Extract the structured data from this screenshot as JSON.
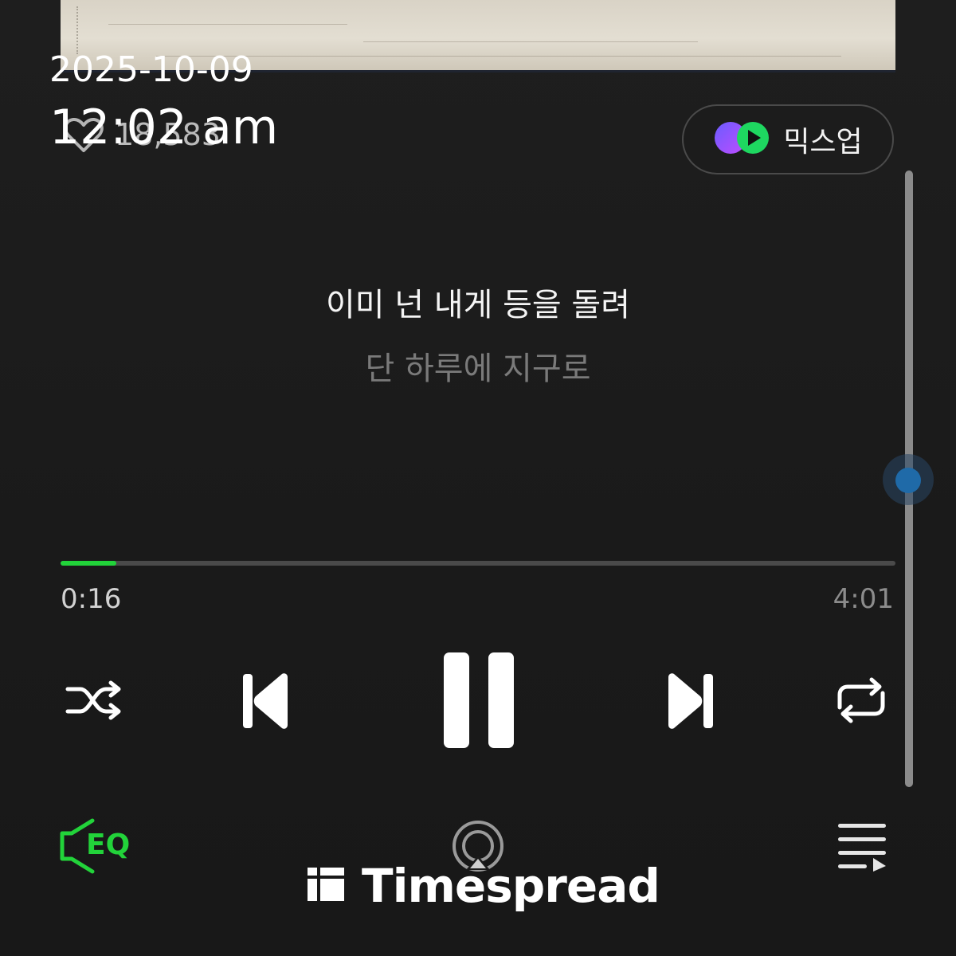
{
  "overlay": {
    "date": "2025-10-09",
    "time": "12:02 am"
  },
  "like": {
    "icon": "heart-icon",
    "count": "18,583"
  },
  "mixup": {
    "icon": "mixup-icon",
    "label": "믹스업"
  },
  "lyrics": {
    "current": "이미 넌 내게 등을 돌려",
    "next": "단 하루에 지구로"
  },
  "player": {
    "elapsed": "0:16",
    "total": "4:01",
    "progress_fraction": 0.0664
  },
  "controls": {
    "shuffle": "shuffle-icon",
    "previous": "skip-previous-icon",
    "pause": "pause-icon",
    "next": "skip-next-icon",
    "repeat": "repeat-icon"
  },
  "bottom_bar": {
    "eq_label": "EQ",
    "cast_icon": "airplay-icon",
    "playlist_icon": "playlist-icon"
  },
  "colors": {
    "accent": "#22d33a",
    "background": "#1b1b1b",
    "lyric_current": "#f5f5f5",
    "lyric_next": "#7a7a7a",
    "scroll_thumb": "#1f6aa8"
  },
  "watermark": {
    "text": "Timespread"
  }
}
